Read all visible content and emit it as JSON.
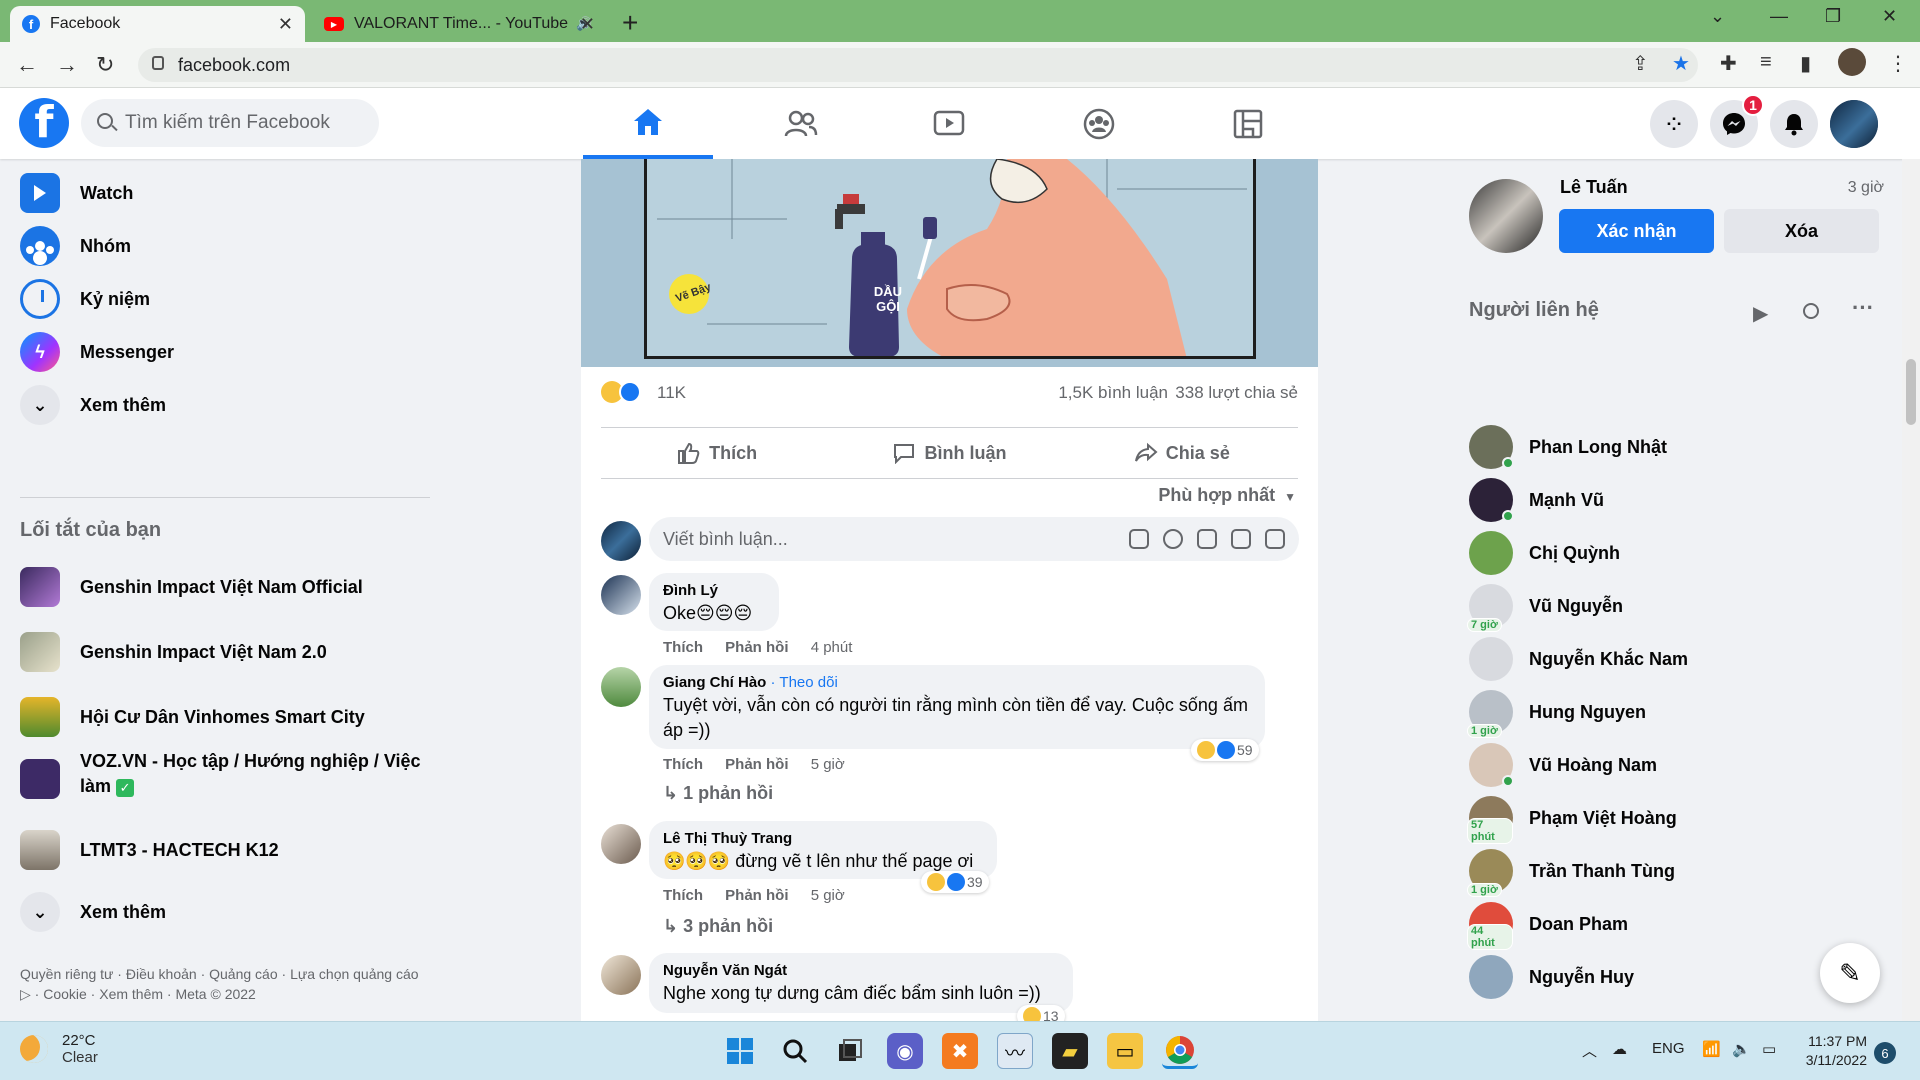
{
  "browser": {
    "tabs": [
      {
        "title": "Facebook",
        "close": "✕"
      },
      {
        "title": "VALORANT Time... - YouTube",
        "close": "✕"
      }
    ],
    "new_tab": "+",
    "url": "facebook.com"
  },
  "header": {
    "logo_letter": "f",
    "search_placeholder": "Tìm kiếm trên Facebook",
    "nav": [
      "home",
      "friends",
      "watch",
      "groups",
      "gaming"
    ],
    "messenger_badge": "1"
  },
  "sidebar": {
    "items": [
      {
        "label": "Watch",
        "icon": "watch-icon"
      },
      {
        "label": "Nhóm",
        "icon": "groups-icon"
      },
      {
        "label": "Kỷ niệm",
        "icon": "memories-icon"
      },
      {
        "label": "Messenger",
        "icon": "messenger-icon"
      },
      {
        "label": "Xem thêm",
        "icon": "chevron-down-icon"
      }
    ],
    "shortcuts_title": "Lối tắt của bạn",
    "shortcuts": [
      {
        "label": "Genshin Impact Việt Nam Official"
      },
      {
        "label": "Genshin Impact Việt Nam 2.0"
      },
      {
        "label": "Hội Cư Dân Vinhomes Smart City"
      },
      {
        "label": "VOZ.VN - Học tập / Hướng nghiệp / Việc làm"
      },
      {
        "label": "LTMT3 - HACTECH K12"
      },
      {
        "label": "Xem thêm"
      }
    ],
    "footer": "Quyền riêng tư · Điều khoản · Quảng cáo · Lựa chọn quảng cáo ▷ · Cookie · Xem thêm · Meta © 2022"
  },
  "post": {
    "comic_texts": {
      "bottle": "DẦU GỘI",
      "stamp": "Vẽ Bậy"
    },
    "reaction_count": "11K",
    "comments_count": "1,5K bình luận",
    "shares_count": "338 lượt chia sẻ",
    "actions": {
      "like": "Thích",
      "comment": "Bình luận",
      "share": "Chia sẻ"
    },
    "sort": "Phù hợp nhất",
    "comment_placeholder": "Viết bình luận...",
    "comments": [
      {
        "name": "Đình Lý",
        "text": "Oke😔😔😔",
        "like": "Thích",
        "reply": "Phản hồi",
        "time": "4 phút"
      },
      {
        "name": "Giang Chí Hào",
        "follow": "· Theo dõi",
        "text": "Tuyệt vời, vẫn còn có người tin rằng mình còn tiền để vay. Cuộc sống ấm áp =))",
        "like": "Thích",
        "reply": "Phản hồi",
        "time": "5 giờ",
        "reactions": "59",
        "replies": "1 phản hồi"
      },
      {
        "name": "Lê Thị Thuỳ Trang",
        "text": "🥺🥺🥺 đừng vẽ t lên như thế page ơi",
        "like": "Thích",
        "reply": "Phản hồi",
        "time": "5 giờ",
        "reactions": "39",
        "replies": "3 phản hồi"
      },
      {
        "name": "Nguyễn Văn Ngát",
        "text": "Nghe xong tự dưng câm điếc bẩm sinh luôn =))",
        "reactions": "13"
      }
    ]
  },
  "right": {
    "friend_request": {
      "name": "Lê Tuấn",
      "time": "3 giờ",
      "confirm": "Xác nhận",
      "delete": "Xóa"
    },
    "contacts_title": "Người liên hệ",
    "contacts": [
      {
        "name": "Phan Long Nhật",
        "status": "online",
        "color": "#6b6f5a"
      },
      {
        "name": "Mạnh Vũ",
        "status": "online",
        "color": "#2c2238"
      },
      {
        "name": "Chị Quỳnh",
        "status": "",
        "color": "#6da24c"
      },
      {
        "name": "Vũ Nguyễn",
        "status": "7 giờ",
        "color": "#d8dadf"
      },
      {
        "name": "Nguyễn Khắc Nam",
        "status": "",
        "color": "#d8dadf"
      },
      {
        "name": "Hung Nguyen",
        "status": "1 giờ",
        "color": "#b9c0c8"
      },
      {
        "name": "Vũ Hoàng Nam",
        "status": "online",
        "color": "#d9c7b8"
      },
      {
        "name": "Phạm Việt Hoàng",
        "status": "57 phút",
        "color": "#8d7a5c"
      },
      {
        "name": "Trần Thanh Tùng",
        "status": "1 giờ",
        "color": "#9a8a58"
      },
      {
        "name": "Doan Pham",
        "status": "44 phút",
        "color": "#e04c3c"
      },
      {
        "name": "Nguyễn Huy",
        "status": "",
        "color": "#8fa7bd"
      }
    ]
  },
  "taskbar": {
    "temperature": "22°C",
    "weather": "Clear",
    "lang": "ENG",
    "time": "11:37 PM",
    "date": "3/11/2022",
    "notifications": "6"
  }
}
